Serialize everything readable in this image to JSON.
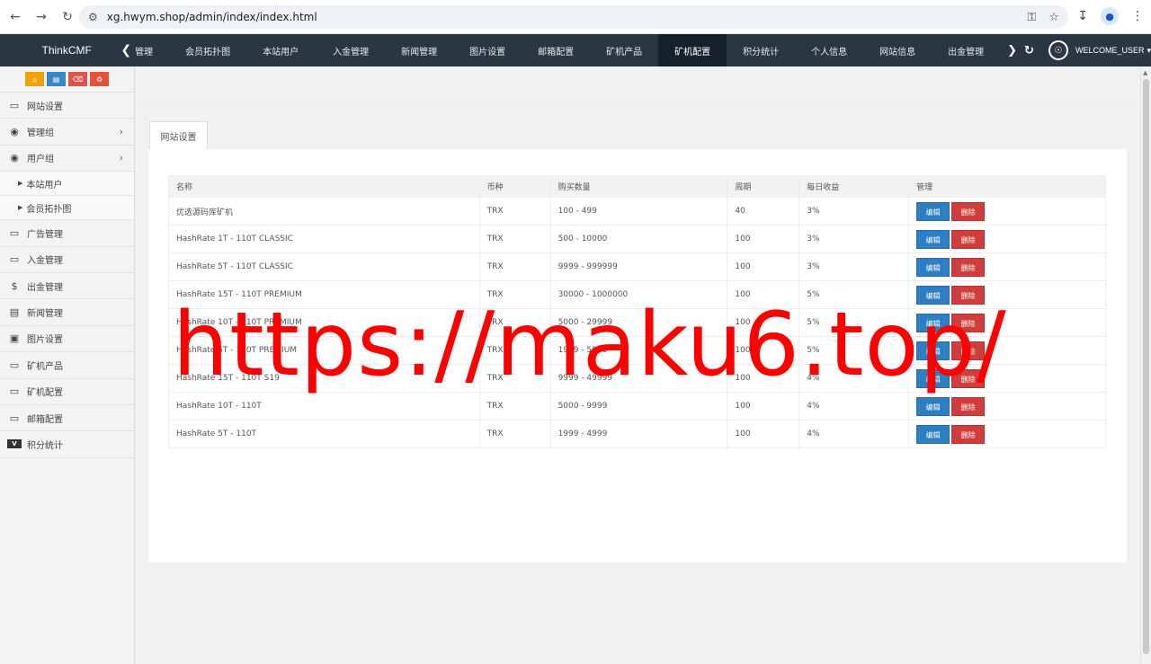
{
  "browser": {
    "url": "xg.hwym.shop/admin/index/index.html"
  },
  "topnav": {
    "brand": "ThinkCMF",
    "items": [
      {
        "label": "管理",
        "active": false
      },
      {
        "label": "会员拓扑图",
        "active": false
      },
      {
        "label": "本站用户",
        "active": false
      },
      {
        "label": "入金管理",
        "active": false
      },
      {
        "label": "新闻管理",
        "active": false
      },
      {
        "label": "图片设置",
        "active": false
      },
      {
        "label": "邮箱配置",
        "active": false
      },
      {
        "label": "矿机产品",
        "active": false
      },
      {
        "label": "矿机配置",
        "active": true
      },
      {
        "label": "积分统计",
        "active": false
      },
      {
        "label": "个人信息",
        "active": false
      },
      {
        "label": "网站信息",
        "active": false
      },
      {
        "label": "出金管理",
        "active": false
      }
    ],
    "welcome": "WELCOME_USER"
  },
  "sidebar": {
    "items": [
      {
        "label": "网站设置",
        "icon": "monitor-icon"
      },
      {
        "label": "管理组",
        "icon": "user-circle-icon",
        "has_children": true
      },
      {
        "label": "用户组",
        "icon": "user-circle-icon",
        "has_children": true,
        "open": true
      },
      {
        "label": "广告管理",
        "icon": "monitor-icon"
      },
      {
        "label": "入金管理",
        "icon": "monitor-icon"
      },
      {
        "label": "出金管理",
        "icon": "dollar-icon"
      },
      {
        "label": "新闻管理",
        "icon": "newspaper-icon"
      },
      {
        "label": "图片设置",
        "icon": "image-icon"
      },
      {
        "label": "矿机产品",
        "icon": "monitor-icon"
      },
      {
        "label": "矿机配置",
        "icon": "monitor-icon"
      },
      {
        "label": "邮箱配置",
        "icon": "monitor-icon"
      },
      {
        "label": "积分统计",
        "icon": "visa-icon"
      }
    ],
    "subitems": [
      {
        "label": "本站用户"
      },
      {
        "label": "会员拓扑图"
      }
    ]
  },
  "main": {
    "tab_label": "网站设置",
    "table": {
      "headers": [
        "名称",
        "币种",
        "购买数量",
        "周期",
        "每日收益",
        "管理"
      ],
      "edit_label": "编辑",
      "delete_label": "删除",
      "rows": [
        {
          "name": "优选源码库矿机",
          "coin": "TRX",
          "amount": "100 - 499",
          "period": "40",
          "daily": "3%"
        },
        {
          "name": "HashRate 1T - 110T CLASSIC",
          "coin": "TRX",
          "amount": "500 - 10000",
          "period": "100",
          "daily": "3%"
        },
        {
          "name": "HashRate 5T - 110T CLASSIC",
          "coin": "TRX",
          "amount": "9999 - 999999",
          "period": "100",
          "daily": "3%"
        },
        {
          "name": "HashRate 15T - 110T PREMIUM",
          "coin": "TRX",
          "amount": "30000 - 1000000",
          "period": "100",
          "daily": "5%"
        },
        {
          "name": "HashRate 10T - 110T PREMIUM",
          "coin": "TRX",
          "amount": "5000 - 29999",
          "period": "100",
          "daily": "5%"
        },
        {
          "name": "HashRate 5T - 110T PREMIUM",
          "coin": "TRX",
          "amount": "1999 - 5000",
          "period": "100",
          "daily": "5%"
        },
        {
          "name": "HashRate 15T - 110T S19",
          "coin": "TRX",
          "amount": "9999 - 49999",
          "period": "100",
          "daily": "4%"
        },
        {
          "name": "HashRate 10T - 110T",
          "coin": "TRX",
          "amount": "5000 - 9999",
          "period": "100",
          "daily": "4%"
        },
        {
          "name": "HashRate 5T - 110T",
          "coin": "TRX",
          "amount": "1999 - 4999",
          "period": "100",
          "daily": "4%"
        }
      ]
    }
  },
  "watermark": "https://maku6.top/"
}
